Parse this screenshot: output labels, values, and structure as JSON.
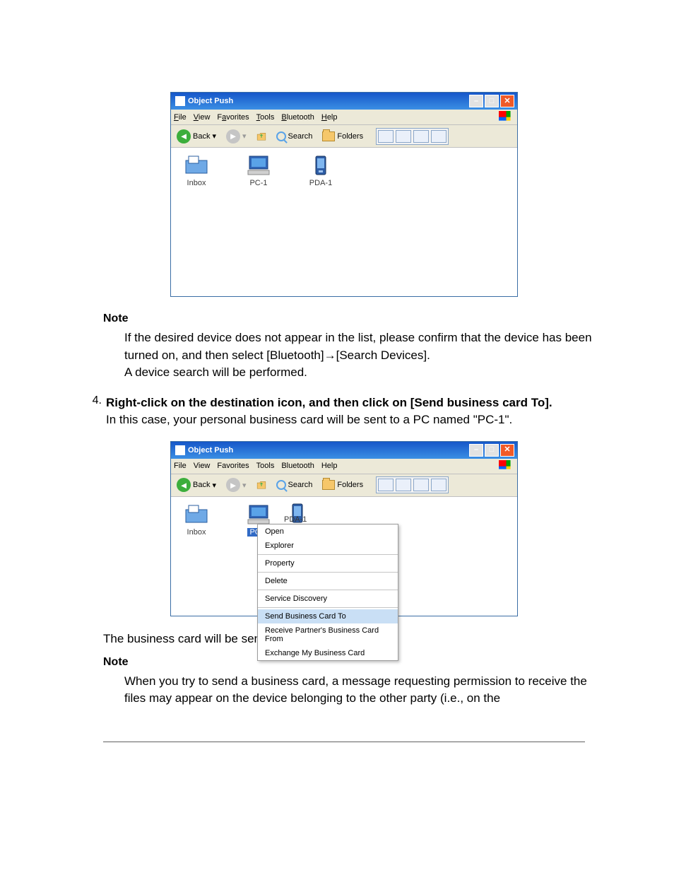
{
  "window": {
    "title": "Object Push",
    "menu": {
      "file": "File",
      "view": "View",
      "favorites": "Favorites",
      "tools": "Tools",
      "bluetooth": "Bluetooth",
      "help": "Help"
    },
    "toolbar": {
      "back": "Back",
      "search": "Search",
      "folders": "Folders"
    },
    "items": {
      "inbox": "Inbox",
      "pc1": "PC-1",
      "pda1": "PDA-1"
    }
  },
  "context_menu": {
    "open": "Open",
    "explorer": "Explorer",
    "property": "Property",
    "delete": "Delete",
    "service_discovery": "Service Discovery",
    "send": "Send Business Card To",
    "receive": "Receive Partner's Business Card From",
    "exchange": "Exchange My Business Card"
  },
  "doc": {
    "note_heading": "Note",
    "note1_line1": "If the desired device does not appear in the list, please confirm that the device has been turned on, and then select [Bluetooth]→[Search Devices].",
    "note1_line2": "A device search will be performed.",
    "step4_num": "4.",
    "step4_bold": "Right-click on the destination icon, and then click on [Send business card To].",
    "step4_line2": "In this case, your personal business card will be sent to a PC named \"PC-1\".",
    "after_send": "The business card will be sent.",
    "note2_body": "When you try to send a business card, a message requesting permission to receive the files may appear on the device belonging to the other party (i.e., on the"
  }
}
